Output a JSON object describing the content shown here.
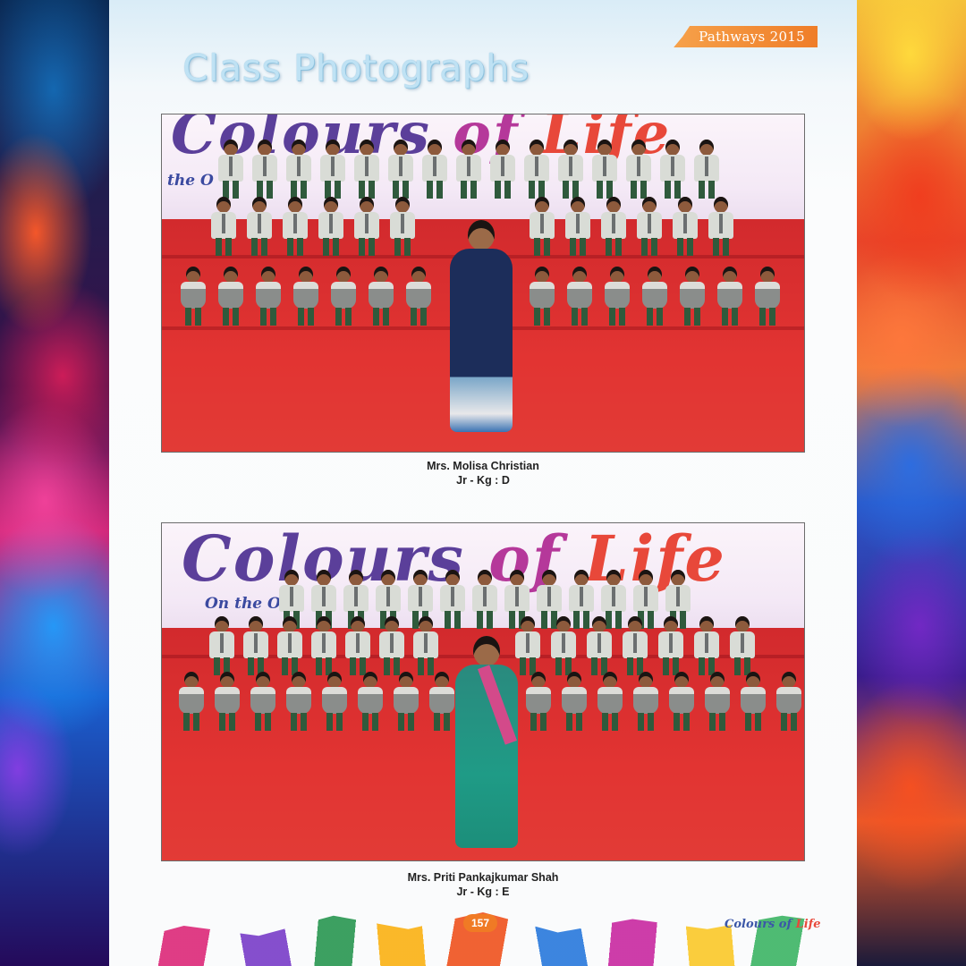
{
  "header": {
    "tab_label": "Pathways 2015",
    "page_heading": "Class Photographs"
  },
  "photos": [
    {
      "banner_main": [
        "Colours",
        " of ",
        "Life"
      ],
      "banner_sub": "the O",
      "teacher": "Mrs. Molisa Christian",
      "class": "Jr - Kg : D"
    },
    {
      "banner_main": [
        "Colours",
        " of ",
        "Life"
      ],
      "banner_sub": "On the O",
      "teacher": "Mrs. Priti Pankajkumar Shah",
      "class": "Jr - Kg : E"
    }
  ],
  "footer": {
    "page_number": "157",
    "logo_text_a": "Colours of ",
    "logo_text_b": "Life"
  },
  "colors": {
    "heading": "#bfe2f4",
    "tab": "#ef7d28",
    "stage": "#d22a2d"
  }
}
